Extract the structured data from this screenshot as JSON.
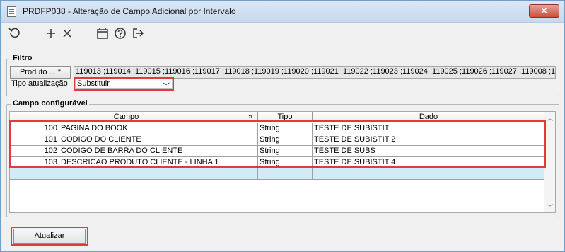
{
  "window": {
    "title": "PRDFP038 - Alteração de Campo Adicional por Intervalo",
    "close_label": "✕"
  },
  "toolbar": {
    "icons": [
      "refresh-icon",
      "add-icon",
      "delete-icon",
      "calendar-icon",
      "help-icon",
      "exit-icon"
    ]
  },
  "filtro": {
    "legend": "Filtro",
    "produto_button": "Produto ... *",
    "codes": "119013 ;119014 ;119015 ;119016 ;119017 ;119018 ;119019 ;119020 ;119021 ;119022 ;119023 ;119024 ;119025 ;119026 ;119027 ;119008 ;1",
    "tipo_label": "Tipo atualização",
    "tipo_value": "Substituir"
  },
  "campo": {
    "legend": "Campo configurável",
    "headers": {
      "campo": "Campo",
      "expand": "»",
      "tipo": "Tipo",
      "dado": "Dado"
    },
    "rows": [
      {
        "num": "100",
        "campo": "PAGINA DO BOOK",
        "tipo": "String",
        "dado": "TESTE DE SUBISTIT"
      },
      {
        "num": "101",
        "campo": "CODIGO DO CLIENTE",
        "tipo": "String",
        "dado": "TESTE DE SUBISTIT 2"
      },
      {
        "num": "102",
        "campo": "CODIGO DE BARRA DO CLIENTE",
        "tipo": "String",
        "dado": "TESTE DE SUBS"
      },
      {
        "num": "103",
        "campo": "DESCRICAO PRODUTO CLIENTE - LINHA 1",
        "tipo": "String",
        "dado": "TESTE DE SUBISTIT 4"
      }
    ]
  },
  "footer": {
    "atualizar_label": "Atualizar"
  }
}
